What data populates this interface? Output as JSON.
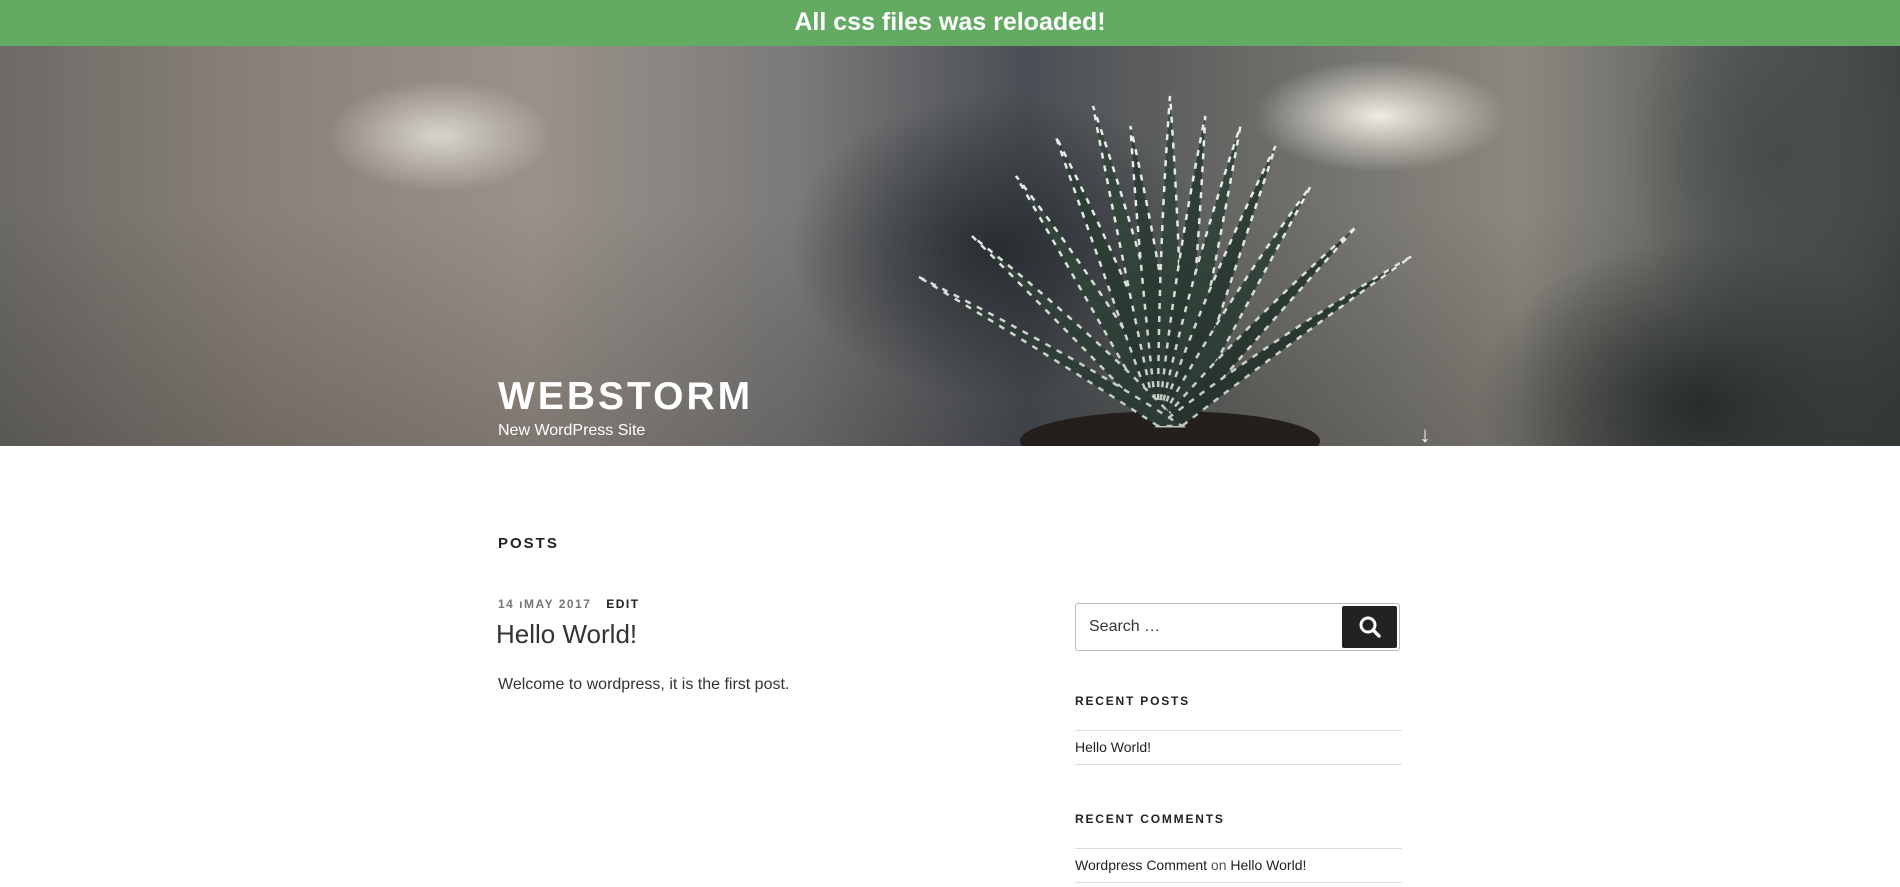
{
  "notice": {
    "message": "All css files was reloaded!"
  },
  "header": {
    "site_title": "WEBSTORM",
    "tagline": "New WordPress Site",
    "scroll_icon": "arrow-down-icon"
  },
  "content": {
    "section_heading": "POSTS",
    "post": {
      "date": "14 ıMAY 2017",
      "edit_label": "EDIT",
      "title": "Hello World!",
      "excerpt": "Welcome to wordpress, it is the first post."
    }
  },
  "sidebar": {
    "search": {
      "placeholder": "Search …",
      "button_icon": "search-icon"
    },
    "recent_posts": {
      "title": "RECENT POSTS",
      "items": [
        {
          "label": "Hello World!"
        }
      ]
    },
    "recent_comments": {
      "title": "RECENT COMMENTS",
      "items": [
        {
          "author": "Wordpress Comment",
          "connector": "on",
          "post": "Hello World!"
        }
      ]
    }
  },
  "colors": {
    "notice_bg": "#63ab63",
    "text_dark": "#222222",
    "button_bg": "#222222",
    "meta_gray": "#767676"
  }
}
